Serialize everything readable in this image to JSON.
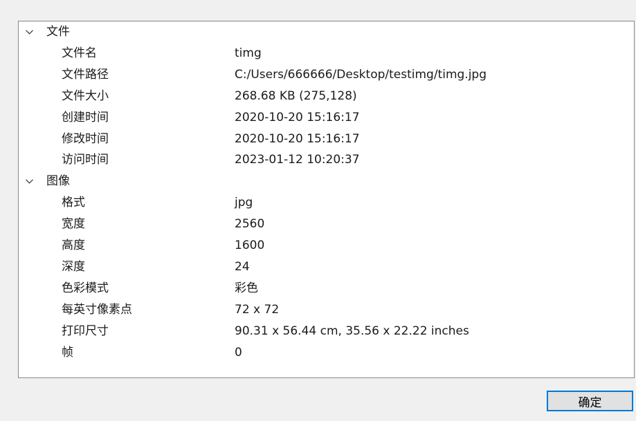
{
  "properties": {
    "groups": [
      {
        "title": "文件",
        "expanded": true,
        "rows": [
          {
            "name": "文件名",
            "value": "timg"
          },
          {
            "name": "文件路径",
            "value": "C:/Users/666666/Desktop/testimg/timg.jpg"
          },
          {
            "name": "文件大小",
            "value": "268.68 KB (275,128)"
          },
          {
            "name": "创建时间",
            "value": "2020-10-20 15:16:17"
          },
          {
            "name": "修改时间",
            "value": "2020-10-20 15:16:17"
          },
          {
            "name": "访问时间",
            "value": "2023-01-12 10:20:37"
          }
        ]
      },
      {
        "title": "图像",
        "expanded": true,
        "rows": [
          {
            "name": "格式",
            "value": "jpg"
          },
          {
            "name": "宽度",
            "value": "2560"
          },
          {
            "name": "高度",
            "value": "1600"
          },
          {
            "name": "深度",
            "value": "24"
          },
          {
            "name": "色彩模式",
            "value": "彩色"
          },
          {
            "name": "每英寸像素点",
            "value": "72 x 72"
          },
          {
            "name": "打印尺寸",
            "value": "90.31 x 56.44 cm, 35.56 x 22.22 inches"
          },
          {
            "name": "帧",
            "value": "0"
          }
        ]
      }
    ]
  },
  "ok_button": {
    "label": "确定"
  },
  "icons": {
    "expand": "chevron-down-icon"
  },
  "colors": {
    "dialog_background": "#f0f0f0",
    "panel_background": "#ffffff",
    "panel_border": "#828790",
    "button_border": "#0078d7",
    "button_background": "#e1e1e1"
  }
}
